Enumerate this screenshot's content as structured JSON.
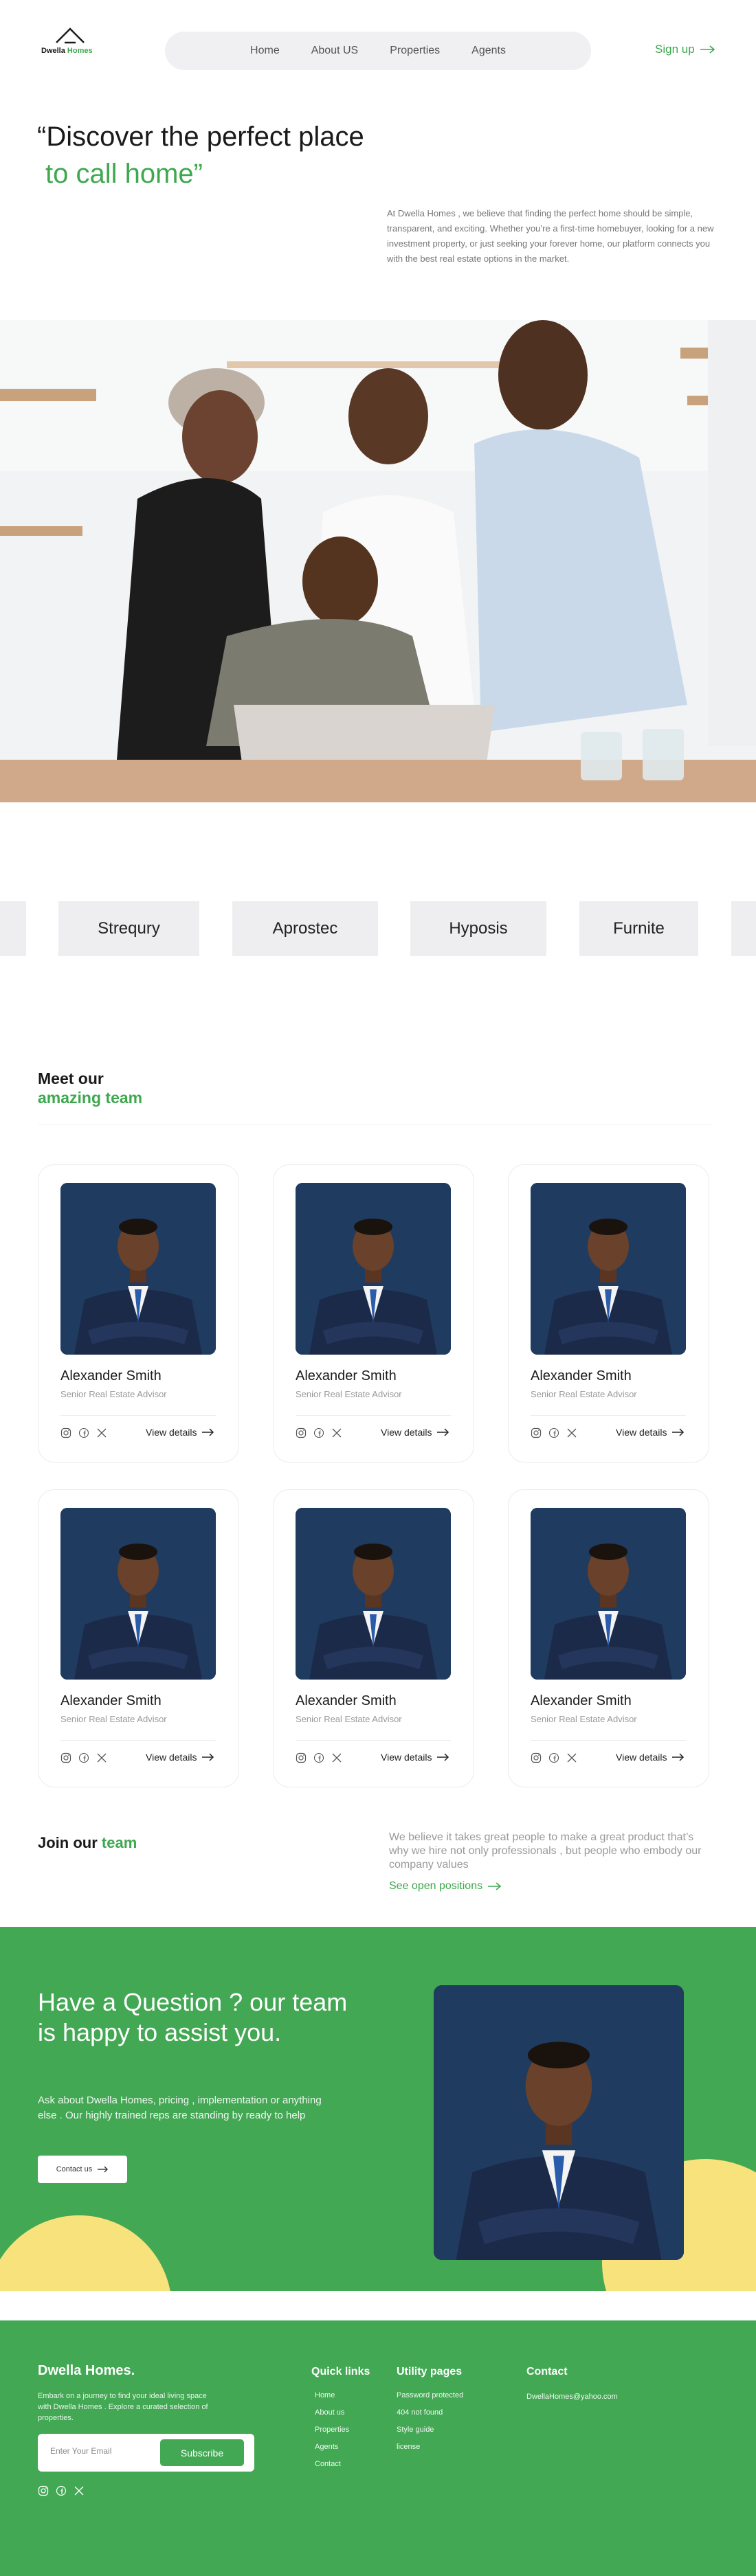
{
  "nav": {
    "brand_prefix": "Dwella",
    "brand_suffix": "Homes",
    "links": [
      "Home",
      "About US",
      "Properties",
      "Agents"
    ],
    "signup": "Sign up"
  },
  "hero": {
    "title_line1": "“Discover the perfect place",
    "title_line2": "to call home”",
    "description": "At Dwella Homes , we believe that finding the perfect home should be simple, transparent, and exciting. Whether you’re a first-time homebuyer, looking for a new investment property, or just seeking your forever home, our platform connects you with the best real estate options in the market."
  },
  "partners": [
    "Strequry",
    "Aprostec",
    "Hyposis",
    "Furnite"
  ],
  "team": {
    "title_line1": "Meet our",
    "title_line2": "amazing team",
    "members": [
      {
        "name": "Alexander Smith",
        "role": "Senior Real Estate Advisor",
        "details": "View details"
      },
      {
        "name": "Alexander Smith",
        "role": "Senior Real Estate Advisor",
        "details": "View details"
      },
      {
        "name": "Alexander Smith",
        "role": "Senior Real Estate Advisor",
        "details": "View details"
      },
      {
        "name": "Alexander Smith",
        "role": "Senior Real Estate Advisor",
        "details": "View details"
      },
      {
        "name": "Alexander Smith",
        "role": "Senior Real Estate Advisor",
        "details": "View details"
      },
      {
        "name": "Alexander Smith",
        "role": "Senior Real Estate Advisor",
        "details": "View details"
      }
    ],
    "social_icons": [
      "instagram-icon",
      "facebook-icon",
      "x-icon"
    ]
  },
  "join": {
    "title_prefix": "Join our",
    "title_highlight": "team",
    "text": "We believe it takes great people to make a great product that’s why we hire not only professionals , but people who embody our company values",
    "link": "See open positions"
  },
  "cta": {
    "title": "Have a Question ? our team is happy to assist you.",
    "text": "Ask about Dwella Homes, pricing , implementation or anything else . Our highly trained reps are standing by ready to help",
    "button": "Contact us"
  },
  "footer": {
    "brand": "Dwella Homes.",
    "description": "Embark on a journey to find your ideal living space with Dwella Homes . Explore a curated selection of  properties.",
    "email_placeholder": "Enter Your Email",
    "subscribe": "Subscribe",
    "quick_links_title": "Quick links",
    "quick_links": [
      "Home",
      "About us",
      "Properties",
      "Agents",
      "Contact"
    ],
    "utility_title": "Utility pages",
    "utility_links": [
      "Password protected",
      "404 not found",
      "Style guide",
      "license"
    ],
    "contact_title": "Contact",
    "contact_email": "DwellaHomes@yahoo.com"
  },
  "colors": {
    "accent": "#42a853",
    "sun": "#f8e27c",
    "text": "#1a1a1a"
  }
}
